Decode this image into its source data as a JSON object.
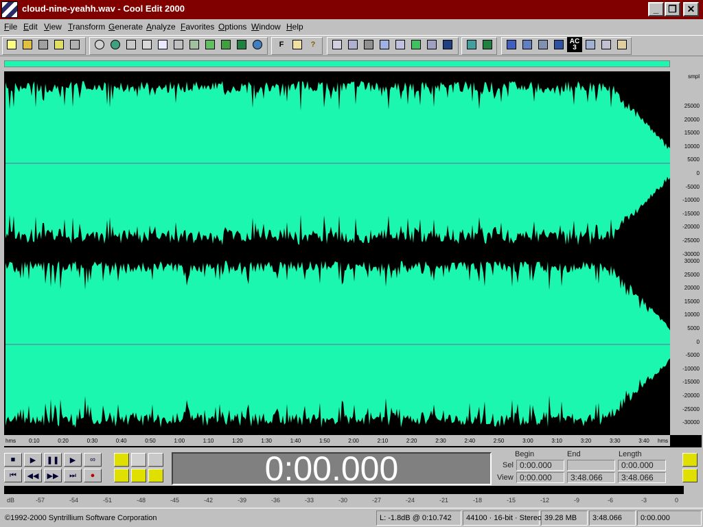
{
  "window": {
    "title": "cloud-nine-yeahh.wav - Cool Edit 2000",
    "minimize_glyph": "_",
    "maximize_glyph": "❐",
    "close_glyph": "✕"
  },
  "menu": [
    "File",
    "Edit",
    "View",
    "Transform",
    "Generate",
    "Analyze",
    "Favorites",
    "Options",
    "Window",
    "Help"
  ],
  "toolbar": {
    "icons": [
      "new-file-icon",
      "open-file-icon",
      "save-icon",
      "save-as-icon",
      "save-all-icon",
      "undo-icon",
      "undo-enable-icon",
      "repeat-icon",
      "select-all-icon",
      "copy-to-new-icon",
      "cut-icon",
      "paste-icon",
      "paste-to-new-icon",
      "mix-paste-icon",
      "trim-icon",
      "recycle-icon",
      "f-icon",
      "script-icon",
      "help-icon",
      "snap-icon",
      "reverse-icon",
      "silence-icon",
      "invert-icon",
      "amplify-icon",
      "envelope-icon",
      "fade-icon",
      "normalize-icon",
      "echo-icon",
      "eq-icon",
      "noise-icon",
      "reverb-icon",
      "filter-icon",
      "analyze-icon",
      "ac3-icon",
      "flanger-icon",
      "pitch-icon",
      "tone-icon"
    ],
    "f_label": "F",
    "help_label": "?",
    "ac3_top": "AC",
    "ac3_bottom": "3"
  },
  "waveform": {
    "color": "#1cf7b0",
    "unit_label": "smpl",
    "y_labels": [
      "30000",
      "25000",
      "20000",
      "15000",
      "10000",
      "5000",
      "0",
      "-5000",
      "-10000",
      "-15000",
      "-20000",
      "-25000",
      "-30000"
    ],
    "top_channel_labels": [
      "25000",
      "20000",
      "15000",
      "10000",
      "5000",
      "0",
      "-5000",
      "-10000",
      "-15000",
      "-20000",
      "-25000",
      "-30000"
    ],
    "bottom_channel_labels": [
      "30000",
      "25000",
      "20000",
      "15000",
      "10000",
      "5000",
      "0",
      "-5000",
      "-10000",
      "-15000",
      "-20000",
      "-25000",
      "-30000"
    ]
  },
  "timeline": {
    "unit_left": "hms",
    "unit_right": "hms",
    "labels": [
      "0:10",
      "0:20",
      "0:30",
      "0:40",
      "0:50",
      "1:00",
      "1:10",
      "1:20",
      "1:30",
      "1:40",
      "1:50",
      "2:00",
      "2:10",
      "2:20",
      "2:30",
      "2:40",
      "2:50",
      "3:00",
      "3:10",
      "3:20",
      "3:30",
      "3:40"
    ]
  },
  "transport": {
    "stop": "■",
    "play": "▶",
    "pause": "❚❚",
    "play_to_end": "▶",
    "loop": "∞",
    "go_start": "⏮",
    "rewind": "◀◀",
    "fast_forward": "▶▶",
    "go_end": "⏭",
    "record": "●"
  },
  "time_display": "0:00.000",
  "selection": {
    "header_begin": "Begin",
    "header_end": "End",
    "header_length": "Length",
    "sel_label": "Sel",
    "view_label": "View",
    "sel_begin": "0:00.000",
    "sel_end": "",
    "sel_length": "0:00.000",
    "view_begin": "0:00.000",
    "view_end": "3:48.066",
    "view_length": "3:48.066"
  },
  "level_meter": {
    "labels": [
      "dB",
      "-57",
      "-54",
      "-51",
      "-48",
      "-45",
      "-42",
      "-39",
      "-36",
      "-33",
      "-30",
      "-27",
      "-24",
      "-21",
      "-18",
      "-15",
      "-12",
      "-9",
      "-6",
      "-3",
      "0"
    ]
  },
  "status": {
    "copyright": "©1992-2000 Syntrillium Software Corporation",
    "level": "L: -1.8dB @   0:10.742",
    "format": "44100 · 16-bit · Stereo",
    "size": "39.28 MB",
    "duration": "3:48.066",
    "position": "0:00.000"
  }
}
